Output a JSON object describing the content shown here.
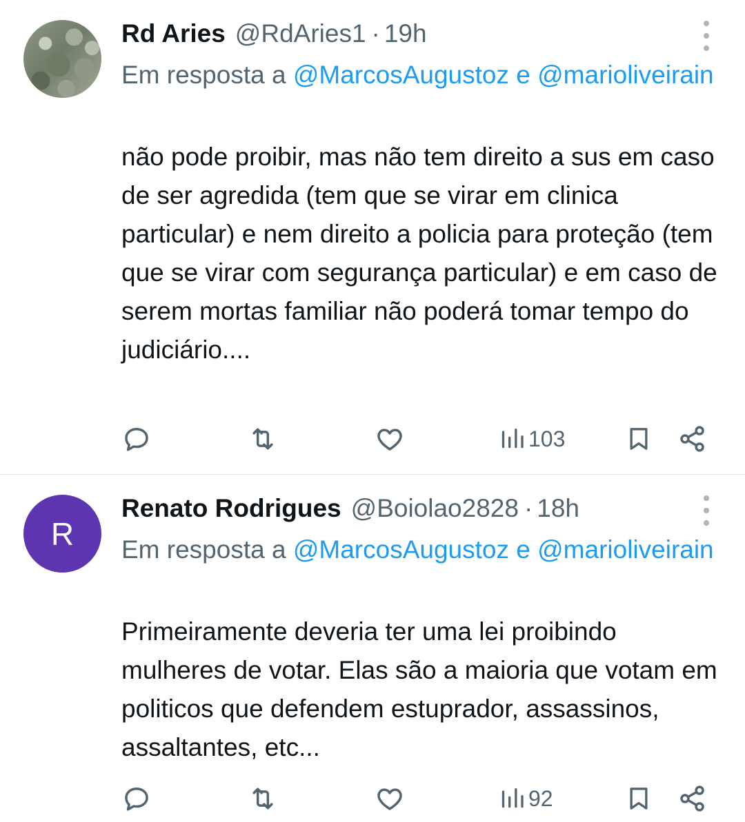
{
  "tweets": [
    {
      "name": "Rd Aries",
      "handle": "@RdAries1",
      "dot": "·",
      "time": "19h",
      "reply_prefix": "Em resposta a",
      "mention_1": "@MarcosAugustoz",
      "reply_and": "e",
      "mention_2": "@marioliveirain",
      "text": "não pode proibir, mas não tem direito a sus em caso de ser agredida (tem que se virar em clinica particular) e nem direito a policia para proteção (tem que se virar com segurança particular) e em caso de serem mortas familiar não poderá tomar tempo do judiciário....",
      "views": "103",
      "avatar": {
        "type": "photo",
        "icon": "profile-photo-plants"
      }
    },
    {
      "name": "Renato Rodrigues",
      "handle": "@Boiolao2828",
      "dot": "·",
      "time": "18h",
      "reply_prefix": "Em resposta a",
      "mention_1": "@MarcosAugustoz",
      "reply_and": "e",
      "mention_2": "@marioliveirain",
      "text": "Primeiramente deveria ter uma lei proibindo mulheres de votar. Elas são a maioria que votam em politicos que defendem estuprador, assassinos, assaltantes, etc...",
      "views": "92",
      "avatar": {
        "type": "letter",
        "letter": "R",
        "color": "#5e35b1"
      }
    }
  ],
  "icons": {
    "more": "more-vertical-icon",
    "reply": "reply-icon",
    "retweet": "retweet-icon",
    "like": "heart-icon",
    "views": "views-chart-icon",
    "bookmark": "bookmark-icon",
    "share": "share-icon"
  },
  "colors": {
    "link": "#1d9bf0",
    "secondary_text": "#536471",
    "primary_text": "#0f1419",
    "avatar_r": "#5e35b1"
  }
}
